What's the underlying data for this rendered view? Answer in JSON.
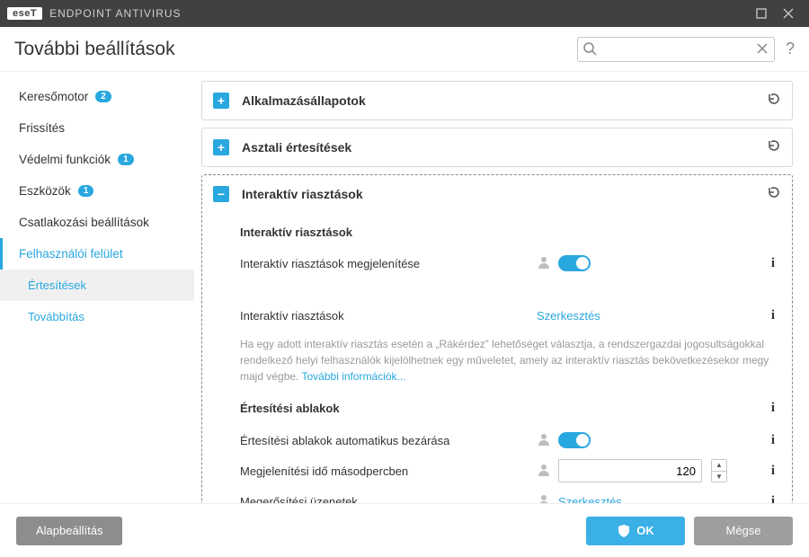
{
  "app": {
    "logo": "eseT",
    "name": "ENDPOINT ANTIVIRUS"
  },
  "header": {
    "title": "További beállítások",
    "search_placeholder": ""
  },
  "sidebar": {
    "items": [
      {
        "label": "Keresőmotor",
        "badge": "2"
      },
      {
        "label": "Frissítés"
      },
      {
        "label": "Védelmi funkciók",
        "badge": "1"
      },
      {
        "label": "Eszközök",
        "badge": "1"
      },
      {
        "label": "Csatlakozási beállítások"
      },
      {
        "label": "Felhasználói felület"
      }
    ],
    "subitems": [
      {
        "label": "Értesítések"
      },
      {
        "label": "Továbbítás"
      }
    ]
  },
  "panels": {
    "app_states": "Alkalmazásállapotok",
    "desktop_notifications": "Asztali értesítések",
    "interactive_alerts": "Interaktív riasztások"
  },
  "section": {
    "interactive_heading": "Interaktív riasztások",
    "show_interactive": "Interaktív riasztások megjelenítése",
    "interactive_label": "Interaktív riasztások",
    "edit": "Szerkesztés",
    "desc_prefix": "Ha egy adott interaktív riasztás esetén a „Rákérdez” lehetőséget választja, a rendszergazdai jogosultságokkal rendelkező helyi felhasználók kijelölhetnek egy műveletet, amely az interaktív riasztás bekövetkezésekor megy majd végbe. ",
    "more_info": "További információk...",
    "notif_heading": "Értesítési ablakok",
    "auto_close": "Értesítési ablakok automatikus bezárása",
    "display_time": "Megjelenítési idő másodpercben",
    "display_time_value": "120",
    "confirm_messages": "Megerősítési üzenetek"
  },
  "footer": {
    "defaults": "Alapbeállítás",
    "ok": "OK",
    "cancel": "Mégse"
  }
}
